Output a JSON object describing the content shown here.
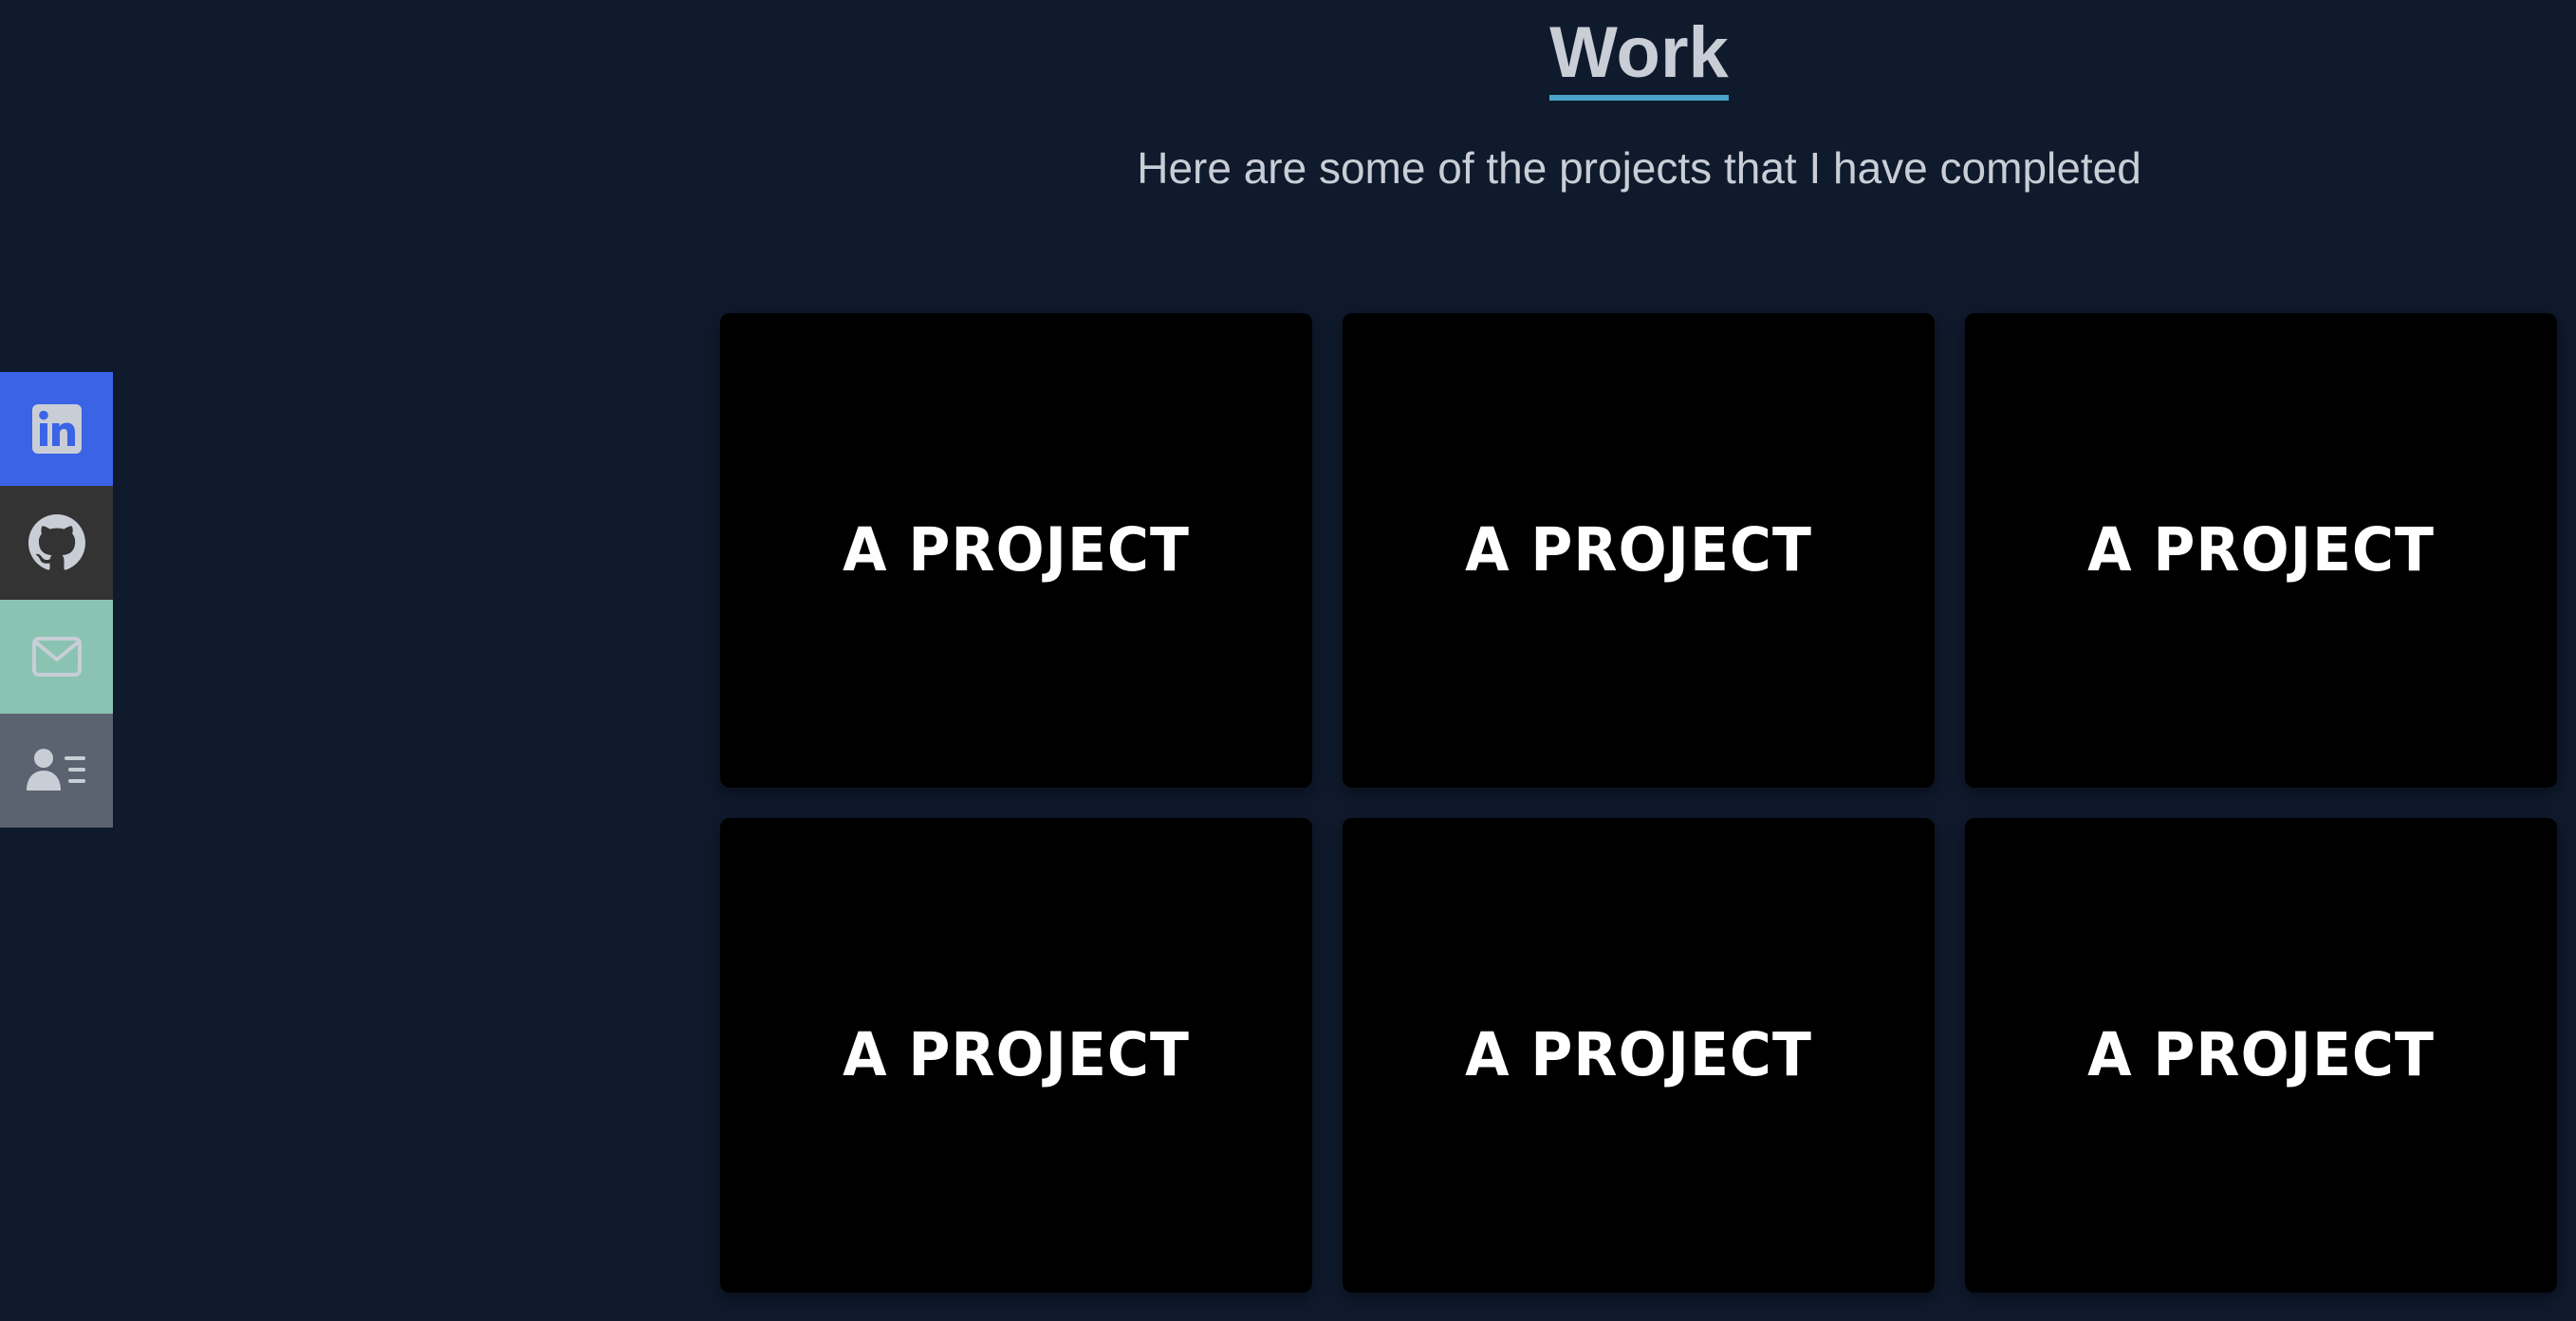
{
  "header": {
    "title": "Work",
    "subtitle": "Here are some of the projects that I have completed"
  },
  "social": [
    {
      "name": "linkedin",
      "icon": "linkedin-icon",
      "color": "#3b63e6"
    },
    {
      "name": "github",
      "icon": "github-icon",
      "color": "#333333"
    },
    {
      "name": "email",
      "icon": "mail-icon",
      "color": "#8ac3b2"
    },
    {
      "name": "resume",
      "icon": "contact-card-icon",
      "color": "#5c6370"
    }
  ],
  "projects": [
    {
      "label": "A PROJECT"
    },
    {
      "label": "A PROJECT"
    },
    {
      "label": "A PROJECT"
    },
    {
      "label": "A PROJECT"
    },
    {
      "label": "A PROJECT"
    },
    {
      "label": "A PROJECT"
    }
  ],
  "colors": {
    "background": "#0f1a2d",
    "text": "#c9ced6",
    "accent_underline": "#4aa3c8",
    "card": "#000000"
  }
}
